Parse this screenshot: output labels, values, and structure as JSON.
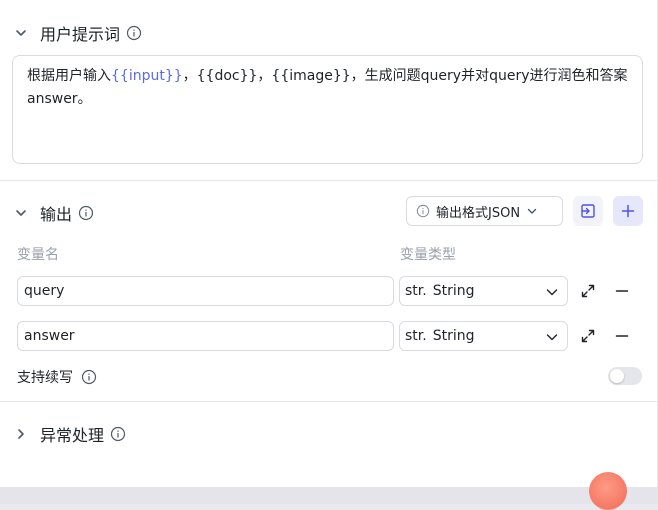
{
  "prompt_section": {
    "title": "用户提示词",
    "text_parts": [
      {
        "text": "根据用户输入",
        "kind": "plain"
      },
      {
        "text": "{{input}}",
        "kind": "var"
      },
      {
        "text": "，{{doc}}，{{image}}，生成问题query并对query进行润色和答案answer。",
        "kind": "plain"
      }
    ]
  },
  "output_section": {
    "title": "输出",
    "format_select": "输出格式JSON",
    "col_name": "变量名",
    "col_type": "变量类型",
    "rows": [
      {
        "name": "query",
        "type_prefix": "str.",
        "type": "String"
      },
      {
        "name": "answer",
        "type_prefix": "str.",
        "type": "String"
      }
    ],
    "continue_label": "支持续写",
    "continue_enabled": false
  },
  "exception_section": {
    "title": "异常处理"
  },
  "colors": {
    "accent": "#4d53e8",
    "var_token": "#5a6be8",
    "border": "#d9dbe0",
    "muted": "#9aa0ab"
  }
}
